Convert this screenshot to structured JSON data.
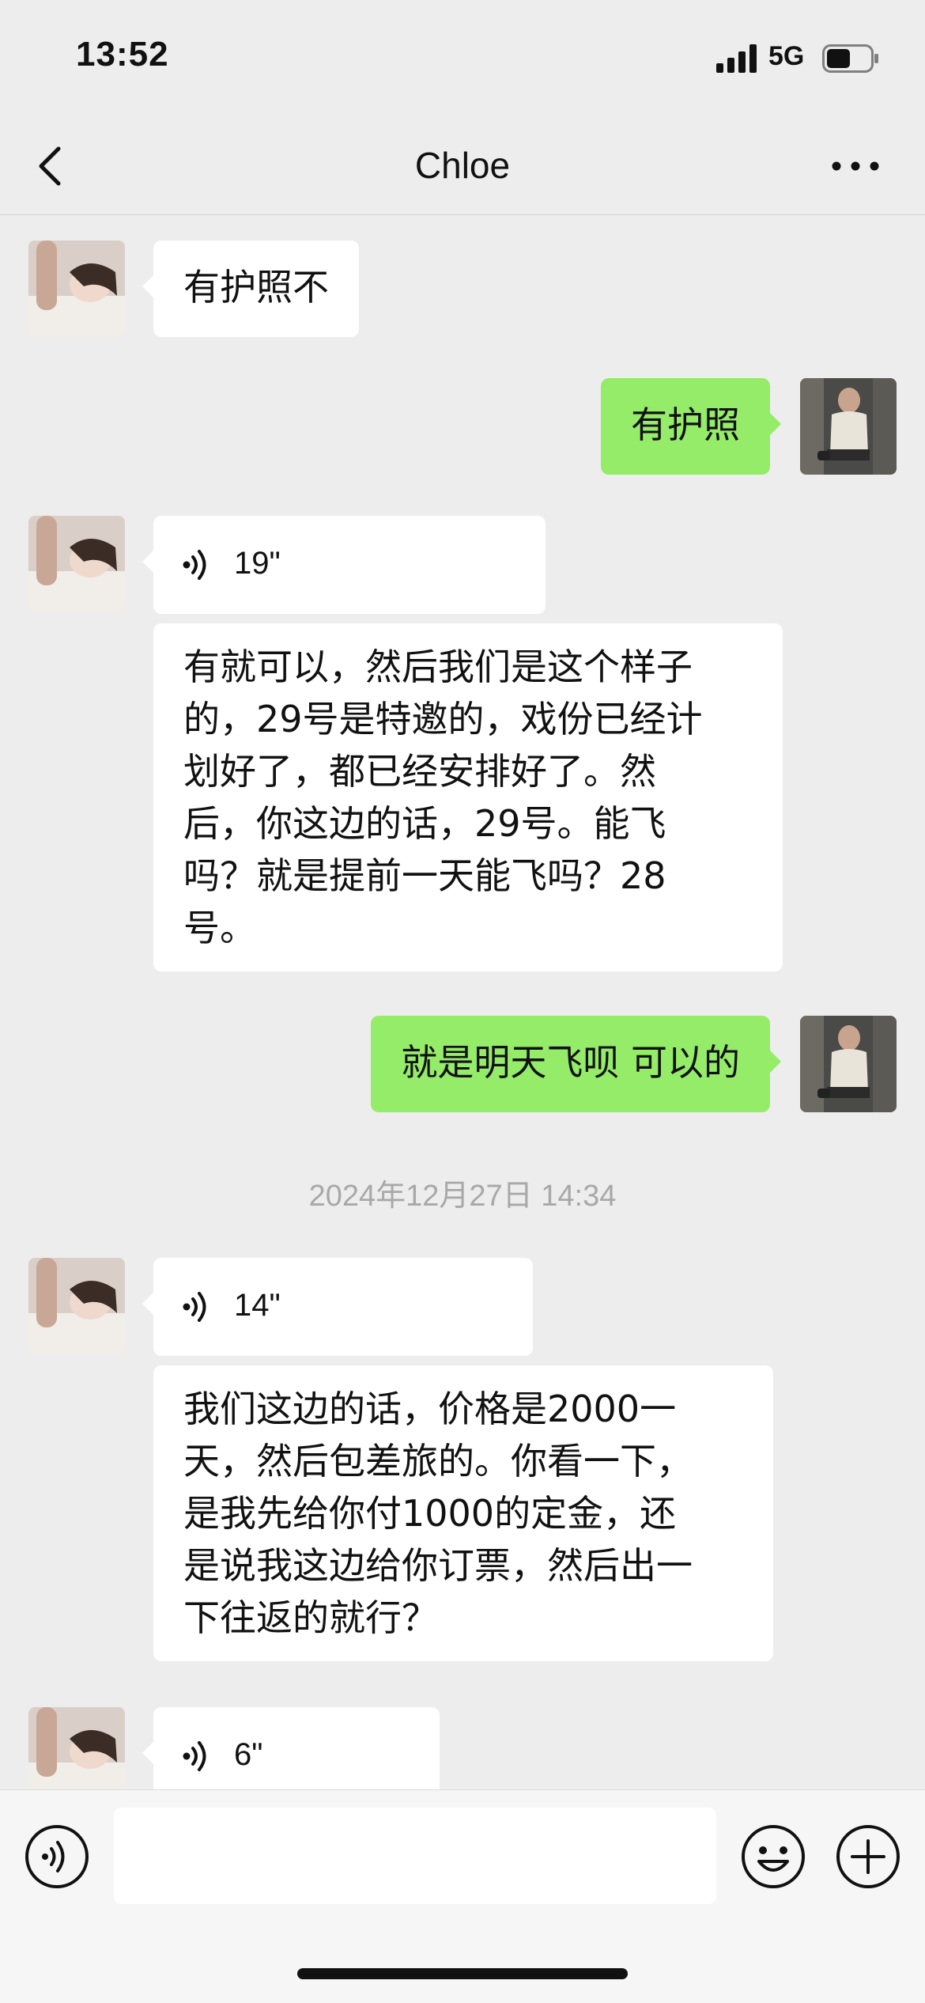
{
  "status_bar": {
    "time": "13:52",
    "network": "5G",
    "battery_level": 0.55
  },
  "nav": {
    "title": "Chloe",
    "back_icon": "chevron-left-icon",
    "more_icon": "more-dots-icon"
  },
  "messages": [
    {
      "side": "in",
      "type": "text",
      "text": "有护照不"
    },
    {
      "side": "out",
      "type": "text",
      "text": "有护照"
    },
    {
      "side": "in",
      "type": "voice",
      "duration": "19\"",
      "transcript": [
        "有就可以，然后我们是这个样子",
        "的，29号是特邀的，戏份已经计",
        "划好了，都已经安排好了。然",
        "后，你这边的话，29号。能飞",
        "吗？就是提前一天能飞吗？28",
        "号。"
      ]
    },
    {
      "side": "out",
      "type": "text",
      "text": "就是明天飞呗 可以的"
    },
    {
      "side": "in",
      "type": "voice",
      "duration": "14\"",
      "transcript": [
        "我们这边的话，价格是2000一",
        "天，然后包差旅的。你看一下，",
        "是我先给你付1000的定金，还",
        "是说我这边给你订票，然后出一",
        "下往返的就行？"
      ]
    },
    {
      "side": "in",
      "type": "voice",
      "duration": "6\""
    }
  ],
  "timestamp": "2024年12月27日 14:34",
  "input_bar": {
    "voice_icon": "voice-input-icon",
    "emoji_icon": "emoji-icon",
    "plus_icon": "plus-icon",
    "text_value": ""
  }
}
